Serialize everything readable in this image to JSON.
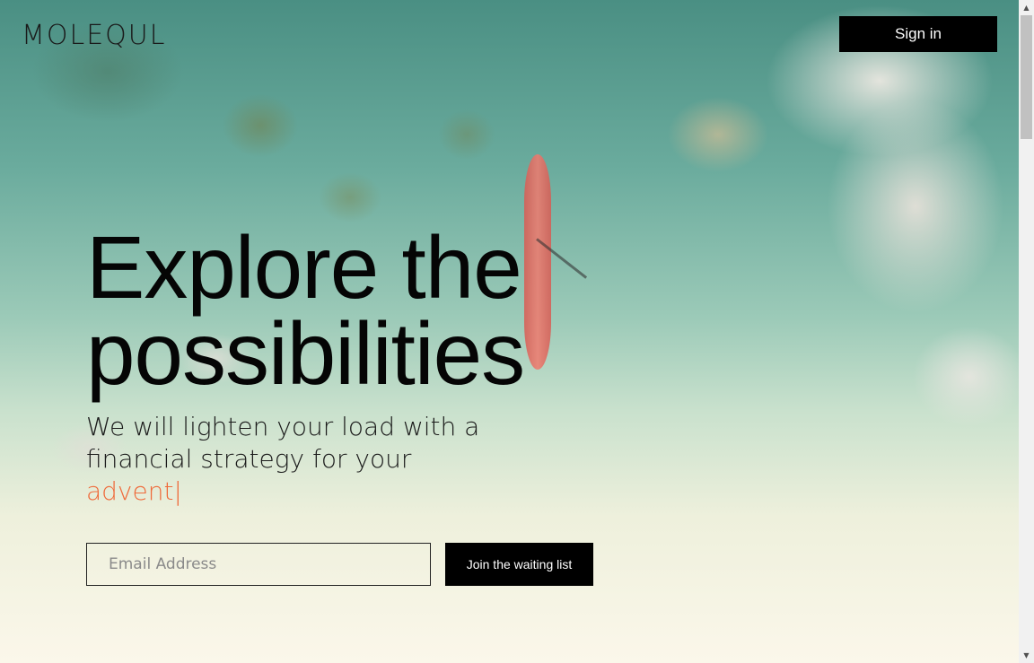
{
  "brand": {
    "logo_text": "MOLEQUL"
  },
  "header": {
    "signin_label": "Sign in"
  },
  "hero": {
    "headline": [
      "Explore the",
      "possibilities"
    ],
    "subhead_lines": [
      "We will lighten your load with a",
      "financial strategy for your"
    ],
    "typing_word": "advent|"
  },
  "form": {
    "email_placeholder": "Email Address",
    "email_value": "",
    "join_label": "Join the waiting list"
  },
  "scrollbar": {
    "up_icon": "▲",
    "down_icon": "▼"
  },
  "colors": {
    "accent": "#ef6a3a",
    "button_bg": "#000000",
    "button_text": "#ffffff"
  }
}
